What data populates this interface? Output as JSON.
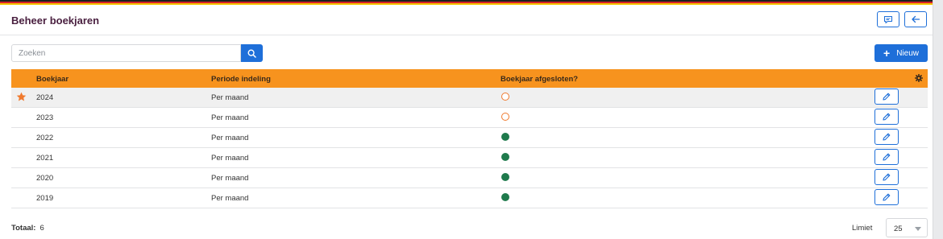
{
  "header": {
    "title": "Beheer boekjaren",
    "comment_icon": "comment-icon",
    "back_icon": "arrow-left-icon"
  },
  "toolbar": {
    "search_placeholder": "Zoeken",
    "search_icon": "search-icon",
    "new_label": "Nieuw",
    "new_icon": "plus-icon"
  },
  "table": {
    "columns": [
      "Boekjaar",
      "Periode indeling",
      "Boekjaar afgesloten?"
    ],
    "settings_icon": "gear-icon",
    "rows": [
      {
        "year": "2024",
        "period": "Per maand",
        "closed": false,
        "favorite": true
      },
      {
        "year": "2023",
        "period": "Per maand",
        "closed": false,
        "favorite": false
      },
      {
        "year": "2022",
        "period": "Per maand",
        "closed": true,
        "favorite": false
      },
      {
        "year": "2021",
        "period": "Per maand",
        "closed": true,
        "favorite": false
      },
      {
        "year": "2020",
        "period": "Per maand",
        "closed": true,
        "favorite": false
      },
      {
        "year": "2019",
        "period": "Per maand",
        "closed": true,
        "favorite": false
      }
    ]
  },
  "footer": {
    "total_label": "Totaal:",
    "total_value": "6",
    "limit_label": "Limiet",
    "limit_value": "25"
  },
  "colors": {
    "accent": "#1e6fd9",
    "header_bar": "#f7931e",
    "open_status": "#f07a2e",
    "closed_status": "#1f7a4c",
    "title": "#4a2040"
  }
}
